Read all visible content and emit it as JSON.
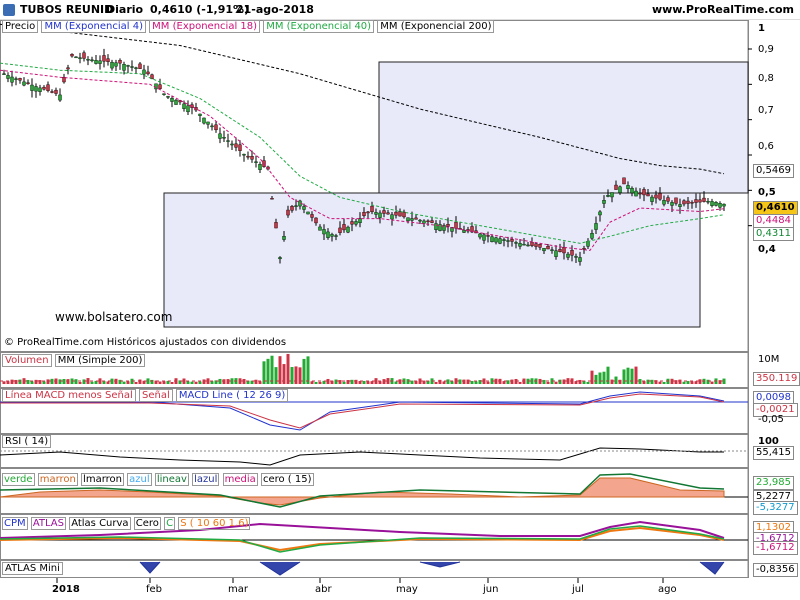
{
  "header": {
    "name": "TUBOS REUNID",
    "period": "Diario",
    "price": "0,4610 (-1,91%)",
    "date": "21-ago-2018",
    "site": "www.ProRealTime.com"
  },
  "price_legend": [
    "Precio",
    "MM (Exponencial 4)",
    "MM (Exponencial 18)",
    "MM (Exponencial 40)",
    "MM (Exponencial 200)"
  ],
  "price_axis": [
    "1",
    "0,9",
    "0,8",
    "0,7",
    "0,6",
    "0,5",
    "0,4"
  ],
  "price_tags": {
    "ema200": "0,5469",
    "last": "0,4610",
    "ema18": "0,4484",
    "ema40": "0,4311"
  },
  "watermark": "www.bolsatero.com",
  "footnote": "© ProRealTime.com  Históricos ajustados con dividendos",
  "volume": {
    "legend": [
      "Volumen",
      "MM (Simple 200)"
    ],
    "axis": "10M",
    "tag": "350.119"
  },
  "macd": {
    "legend": [
      "Línea MACD menos Señal",
      "Señal",
      "MACD Line ( 12 26 9)"
    ],
    "axis_top": "0,0098",
    "axis_bottom": "-0,05",
    "tag": "-0,0021"
  },
  "rsi": {
    "legend": "RSI ( 14)",
    "axis": "100",
    "tag": "55,415"
  },
  "colors_panel": {
    "legend": [
      "verde",
      "marron",
      "lmarron",
      "azul",
      "lineav",
      "lazul",
      "media",
      "cero ( 15)"
    ],
    "tag1": "23,985",
    "tag2": "5,2277",
    "tag3": "-5,3277"
  },
  "cpm": {
    "legend": [
      "CPM",
      "ATLAS",
      "Atlas Curva",
      "Cero",
      "C",
      "S ( 10 60 1.6)"
    ],
    "tag1": "1,1302",
    "tag2": "-1,6712",
    "tag3": "-1,6712"
  },
  "atlas_mini": {
    "legend": "ATLAS Mini",
    "tag": "-0,8356"
  },
  "months": [
    "2018",
    "feb",
    "mar",
    "abr",
    "may",
    "jun",
    "jul",
    "ago"
  ],
  "colors": {
    "ema4": "#2233cc",
    "ema18": "#cc1177",
    "ema40": "#22aa44",
    "ema200": "#000000",
    "up": "#22aa33",
    "down": "#cc3344"
  },
  "chart_data": {
    "type": "candlestick",
    "title": "TUBOS REUNID Diario",
    "ylim": [
      0.27,
      1.0
    ],
    "x": [
      "2018",
      "feb",
      "mar",
      "abr",
      "may",
      "jun",
      "jul",
      "ago"
    ],
    "close": [
      0.84,
      0.8,
      0.76,
      0.88,
      0.86,
      0.84,
      0.78,
      0.7,
      0.6,
      0.52,
      0.31,
      0.4,
      0.37,
      0.41,
      0.43,
      0.41,
      0.4,
      0.37,
      0.35,
      0.33,
      0.31,
      0.44,
      0.51,
      0.48,
      0.47,
      0.46
    ],
    "ema200": [
      0.97,
      0.95,
      0.93,
      0.91,
      0.87,
      0.83,
      0.78,
      0.73,
      0.69,
      0.65,
      0.62,
      0.59,
      0.57,
      0.56,
      0.55,
      0.547
    ],
    "ema40": [
      0.86,
      0.84,
      0.8,
      0.73,
      0.64,
      0.52,
      0.46,
      0.43,
      0.41,
      0.39,
      0.36,
      0.34,
      0.37,
      0.42,
      0.431
    ],
    "ema18": [
      0.84,
      0.82,
      0.75,
      0.63,
      0.5,
      0.42,
      0.4,
      0.4,
      0.38,
      0.35,
      0.33,
      0.4,
      0.44,
      0.448
    ]
  }
}
